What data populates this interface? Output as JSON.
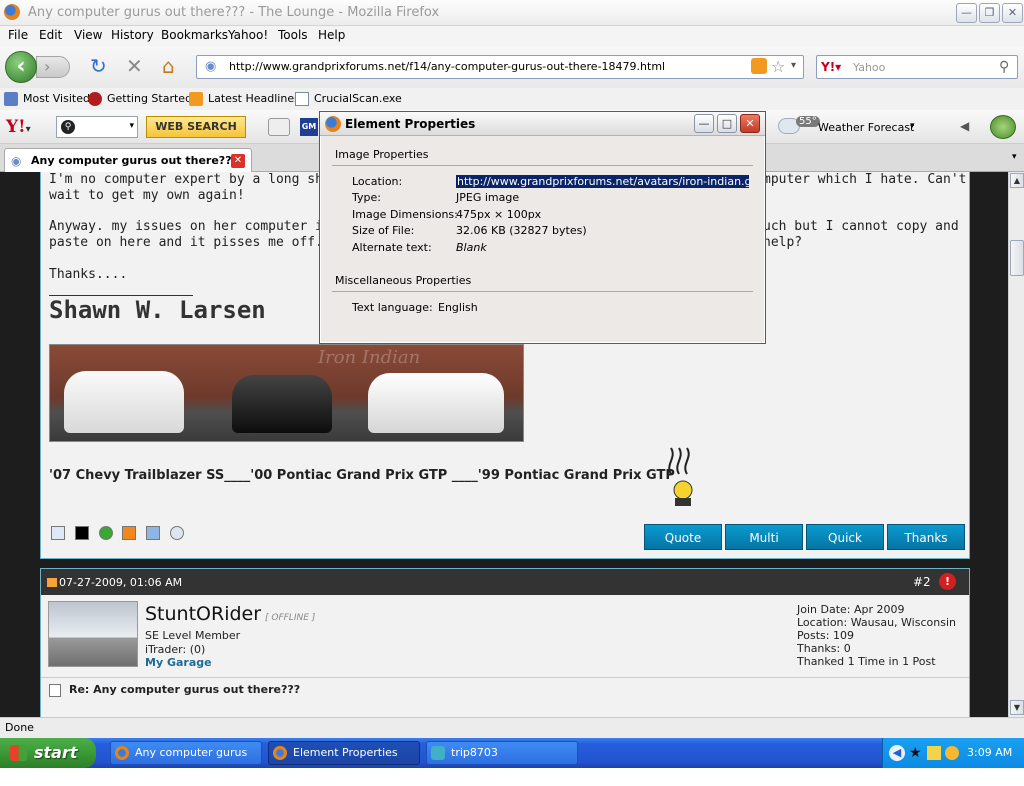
{
  "window": {
    "title": "Any computer gurus out there??? - The Lounge - Mozilla Firefox"
  },
  "menu": [
    "File",
    "Edit",
    "View",
    "History",
    "Bookmarks",
    "Yahoo!",
    "Tools",
    "Help"
  ],
  "nav": {
    "url": "http://www.grandprixforums.net/f14/any-computer-gurus-out-there-18479.html",
    "search_placeholder": "Yahoo"
  },
  "bookmarks": [
    "Most Visited",
    "Getting Started",
    "Latest Headlines",
    "CrucialScan.exe"
  ],
  "yahoo_toolbar": {
    "search_button": "WEB SEARCH",
    "temp": "55°",
    "weather": "Weather Forecast"
  },
  "tab": {
    "title": "Any computer gurus out there??..."
  },
  "post1": {
    "line1": "I'm no computer expert by a long shot...",
    "line1b": "mputer which I hate. Can't",
    "line2": "wait to get my own again!",
    "line3": "Anyway. my issues on her computer is I",
    "line3b": "uch but I cannot copy and",
    "line4": "paste on here and it pisses me off. I hop",
    "line4b": "help?",
    "line5": "Thanks....",
    "sig_name": "Shawn W. Larsen",
    "banner_text": "Iron Indian",
    "cars": "'07 Chevy Trailblazer SS____'00 Pontiac Grand Prix GTP ____'99 Pontiac Grand Prix GTP",
    "buttons": [
      "Quote",
      "Multi",
      "Quick",
      "Thanks"
    ]
  },
  "post2": {
    "date": "07-27-2009, 01:06 AM",
    "number": "#2",
    "username": "StuntORider",
    "status": "[ OFFLINE ]",
    "rank": "SE Level Member",
    "itrader": "iTrader: (0)",
    "garage": "My Garage",
    "join": "Join Date: Apr 2009",
    "location": "Location: Wausau, Wisconsin",
    "posts": "Posts: 109",
    "thanks": "Thanks: 0",
    "thanked": "Thanked 1 Time in 1 Post",
    "reply_title": "Re: Any computer gurus out there???"
  },
  "status_bar": "Done",
  "taskbar": {
    "start": "start",
    "items": [
      "Any computer gurus ...",
      "Element Properties",
      "trip8703"
    ],
    "clock": "3:09 AM"
  },
  "dialog": {
    "title": "Element Properties",
    "section1": "Image Properties",
    "location_label": "Location:",
    "location": "http://www.grandprixforums.net/avatars/iron-indian.gif?type",
    "type_label": "Type:",
    "type": "JPEG image",
    "dims_label": "Image Dimensions:",
    "dims": "475px × 100px",
    "size_label": "Size of File:",
    "size": "32.06 KB (32827 bytes)",
    "alt_label": "Alternate text:",
    "alt": "Blank",
    "section2": "Miscellaneous Properties",
    "lang_label": "Text language:",
    "lang": "English"
  }
}
